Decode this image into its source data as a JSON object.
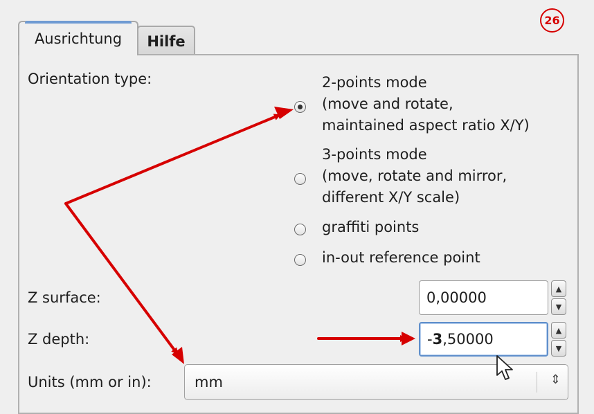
{
  "tabs": [
    {
      "label": "Ausrichtung",
      "active": true
    },
    {
      "label": "Hilfe",
      "active": false
    }
  ],
  "badge": "26",
  "orientation": {
    "label": "Orientation type:",
    "options": [
      {
        "lines": [
          "2-points mode",
          "(move and rotate,",
          "maintained aspect ratio X/Y)"
        ],
        "checked": true
      },
      {
        "lines": [
          "3-points mode",
          "(move, rotate and mirror,",
          "different X/Y scale)"
        ],
        "checked": false
      },
      {
        "lines": [
          "graffiti points"
        ],
        "checked": false
      },
      {
        "lines": [
          "in-out reference point"
        ],
        "checked": false
      }
    ]
  },
  "z_surface": {
    "label": "Z surface:",
    "value": "0,00000"
  },
  "z_depth": {
    "label": "Z depth:",
    "value_prefix": "-",
    "value_bold": "3",
    "value_rest": ",50000"
  },
  "units": {
    "label": "Units (mm or in):",
    "value": "mm"
  },
  "icons": {
    "spin_up": "chevron-up-icon",
    "spin_down": "chevron-down-icon",
    "combo": "up-down-chevron-icon",
    "cursor": "mouse-pointer-icon"
  },
  "colors": {
    "annotation": "#d60000",
    "focus": "#5f8fcb",
    "tab_accent": "#6f9bd3"
  }
}
